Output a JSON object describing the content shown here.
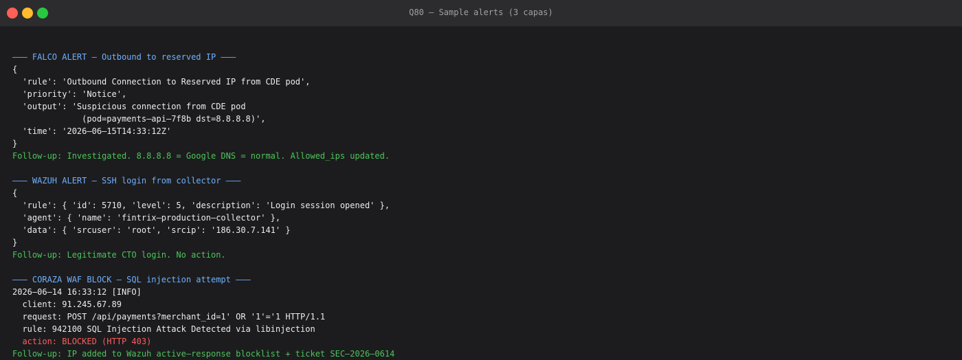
{
  "window": {
    "title": "Q80 — Sample alerts (3 capas)"
  },
  "colors": {
    "background": "#1c1c1e",
    "titlebar": "#2c2c2e",
    "header": "#6eb0ff",
    "text": "#ececec",
    "followup": "#4cc45a",
    "error": "#ff5c5c"
  },
  "terminal": {
    "lines": [
      "",
      "——— FALCO ALERT — Outbound to reserved IP ———",
      "{",
      "  'rule': 'Outbound Connection to Reserved IP from CDE pod',",
      "  'priority': 'Notice',",
      "  'output': 'Suspicious connection from CDE pod",
      "              (pod=payments—api—7f8b dst=8.8.8.8)',",
      "  'time': '2026—06—15T14:33:12Z'",
      "}",
      "Follow-up: Investigated. 8.8.8.8 = Google DNS = normal. Allowed_ips updated.",
      "",
      "——— WAZUH ALERT — SSH login from collector ———",
      "{",
      "  'rule': { 'id': 5710, 'level': 5, 'description': 'Login session opened' },",
      "  'agent': { 'name': 'fintrix—production—collector' },",
      "  'data': { 'srcuser': 'root', 'srcip': '186.30.7.141' }",
      "}",
      "Follow-up: Legitimate CTO login. No action.",
      "",
      "——— CORAZA WAF BLOCK — SQL injection attempt ———",
      "2026—06—14 16:33:12 [INFO]",
      "  client: 91.245.67.89",
      "  request: POST /api/payments?merchant_id=1' OR '1'='1 HTTP/1.1",
      "  rule: 942100 SQL Injection Attack Detected via libinjection",
      "  action: BLOCKED (HTTP 403)",
      "Follow-up: IP added to Wazuh active—response blocklist + ticket SEC—2026—0614"
    ]
  }
}
